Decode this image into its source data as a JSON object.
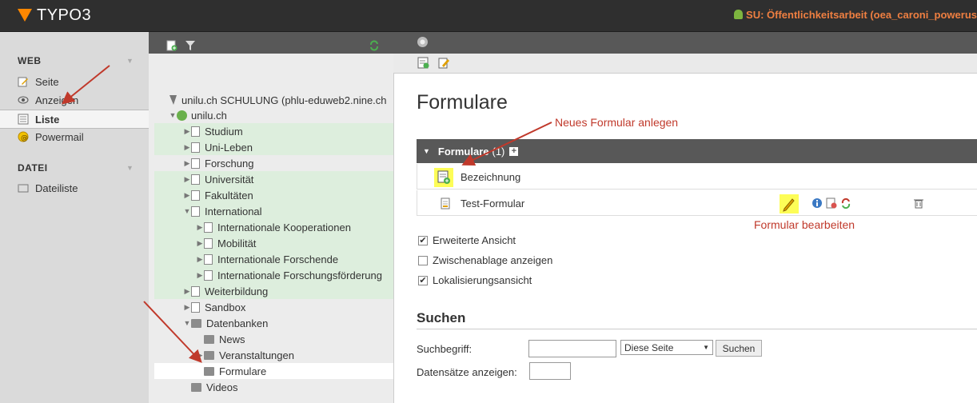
{
  "app": {
    "logo_text": "TYPO3",
    "user_label": "SU: Öffentlichkeitsarbeit (oea_caroni_powerus"
  },
  "modules": {
    "web_title": "WEB",
    "web_items": [
      {
        "label": "Seite"
      },
      {
        "label": "Anzeigen"
      },
      {
        "label": "Liste"
      },
      {
        "label": "Powermail"
      }
    ],
    "file_title": "DATEI",
    "file_items": [
      {
        "label": "Dateiliste"
      }
    ]
  },
  "tree": {
    "root": "unilu.ch SCHULUNG (phlu-eduweb2.nine.ch",
    "site": "unilu.ch",
    "nodes": [
      "Studium",
      "Uni-Leben",
      "Forschung",
      "Universität",
      "Fakultäten",
      "International",
      "Internationale Kooperationen",
      "Mobilität",
      "Internationale Forschende",
      "Internationale Forschungsförderung",
      "Weiterbildung",
      "Sandbox",
      "Datenbanken",
      "News",
      "Veranstaltungen",
      "Formulare",
      "Videos"
    ]
  },
  "content": {
    "title": "Formulare",
    "table_header": "Formulare",
    "table_count": "(1)",
    "col_header": "Bezeichnung",
    "row_title": "Test-Formular",
    "options": [
      "Erweiterte Ansicht",
      "Zwischenablage anzeigen",
      "Lokalisierungsansicht"
    ],
    "options_checked": [
      true,
      false,
      true
    ],
    "search_title": "Suchen",
    "search_label": "Suchbegriff:",
    "search_value": "",
    "scope_select": "Diese Seite",
    "search_button": "Suchen",
    "records_label": "Datensätze anzeigen:",
    "records_value": ""
  },
  "annotations": {
    "new_form": "Neues Formular anlegen",
    "edit_form": "Formular bearbeiten"
  },
  "colors": {
    "accent": "#ff8700",
    "user": "#ef7f41",
    "annotation": "#c0392b",
    "highlight": "#fdfd57",
    "tree_highlight": "#ddeedd"
  }
}
